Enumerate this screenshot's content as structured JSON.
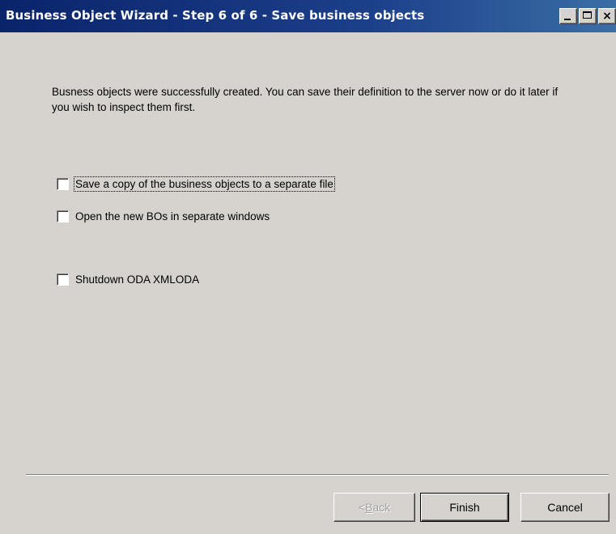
{
  "window": {
    "title": "Business Object Wizard - Step 6 of 6 - Save business objects",
    "controls": {
      "minimize_icon": "minimize-icon",
      "maximize_icon": "maximize-icon",
      "close_glyph": "×"
    }
  },
  "message": "Busness objects were successfully created. You can save their definition to the server now or do it later if you wish to inspect them first.",
  "options": [
    {
      "label": "Save a copy of the business objects to a separate file",
      "checked": false
    },
    {
      "label": "Open the new BOs in separate windows",
      "checked": false
    },
    {
      "label": "Shutdown ODA XMLODA",
      "checked": false
    }
  ],
  "buttons": {
    "back_mnemonic": "B",
    "back_rest": "ack",
    "back_prefix": "< ",
    "finish": "Finish",
    "cancel": "Cancel"
  },
  "colors": {
    "title_bar": "#0a246a",
    "face": "#d6d3ce",
    "disabled_text": "#a0a0a0"
  }
}
